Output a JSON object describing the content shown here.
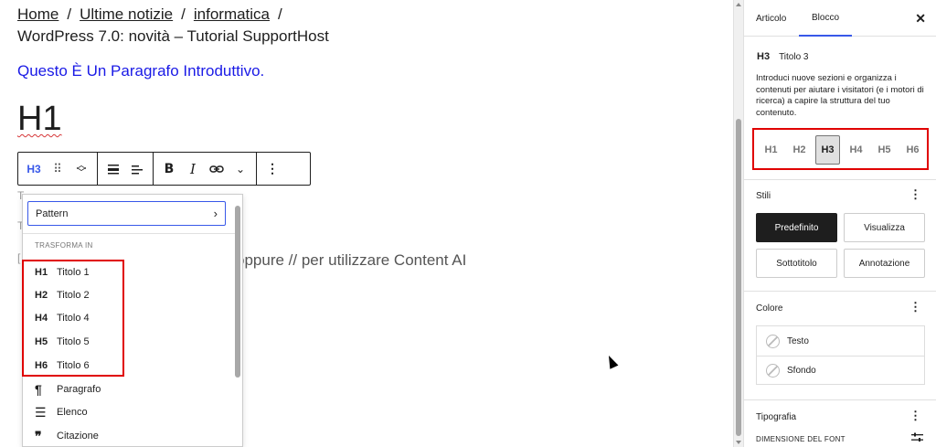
{
  "breadcrumb": {
    "items": [
      "Home",
      "Ultime notizie",
      "informatica"
    ],
    "separator": "/"
  },
  "post": {
    "title": "WordPress 7.0: novità – Tutorial SupportHost",
    "intro": "Questo È Un Paragrafo Introduttivo.",
    "h1": "H1",
    "hint": "oppure // per utilizzare Content AI"
  },
  "toolbar": {
    "block_type": "H3",
    "drag_icon": "⠿",
    "move_icon": "⌃⌄",
    "align_icon": "≡",
    "text_align_icon": "≡",
    "bold": "B",
    "italic": "I",
    "link_icon": "⊖",
    "more_rich_icon": "⌄",
    "options_icon": "⋮"
  },
  "transform_menu": {
    "pattern_label": "Pattern",
    "section_label": "TRASFORMA IN",
    "headings": [
      {
        "icon": "H1",
        "label": "Titolo 1"
      },
      {
        "icon": "H2",
        "label": "Titolo 2"
      },
      {
        "icon": "H4",
        "label": "Titolo 4"
      },
      {
        "icon": "H5",
        "label": "Titolo 5"
      },
      {
        "icon": "H6",
        "label": "Titolo 6"
      }
    ],
    "others": [
      {
        "icon": "¶",
        "label": "Paragrafo"
      },
      {
        "icon": "☰",
        "label": "Elenco"
      },
      {
        "icon": "❞",
        "label": "Citazione"
      }
    ]
  },
  "sidebar": {
    "tabs": [
      "Articolo",
      "Blocco"
    ],
    "active_tab": "Blocco",
    "close_icon": "✕",
    "block": {
      "icon": "H3",
      "name": "Titolo 3",
      "description": "Introduci nuove sezioni e organizza i contenuti per aiutare i visitatori (e i motori di ricerca) a capire la struttura del tuo contenuto."
    },
    "levels": [
      "H1",
      "H2",
      "H3",
      "H4",
      "H5",
      "H6"
    ],
    "active_level": "H3",
    "styles": {
      "title": "Stili",
      "options": [
        "Predefinito",
        "Visualizza",
        "Sottotitolo",
        "Annotazione"
      ],
      "active": "Predefinito"
    },
    "color": {
      "title": "Colore",
      "items": [
        "Testo",
        "Sfondo"
      ]
    },
    "typography": {
      "title": "Tipografia",
      "font_size_label": "DIMENSIONE DEL FONT"
    },
    "kebab_icon": "⋮"
  },
  "colors": {
    "accent": "#3858e9",
    "highlight_box": "#e00000",
    "intro_text": "#1a1ae6"
  }
}
